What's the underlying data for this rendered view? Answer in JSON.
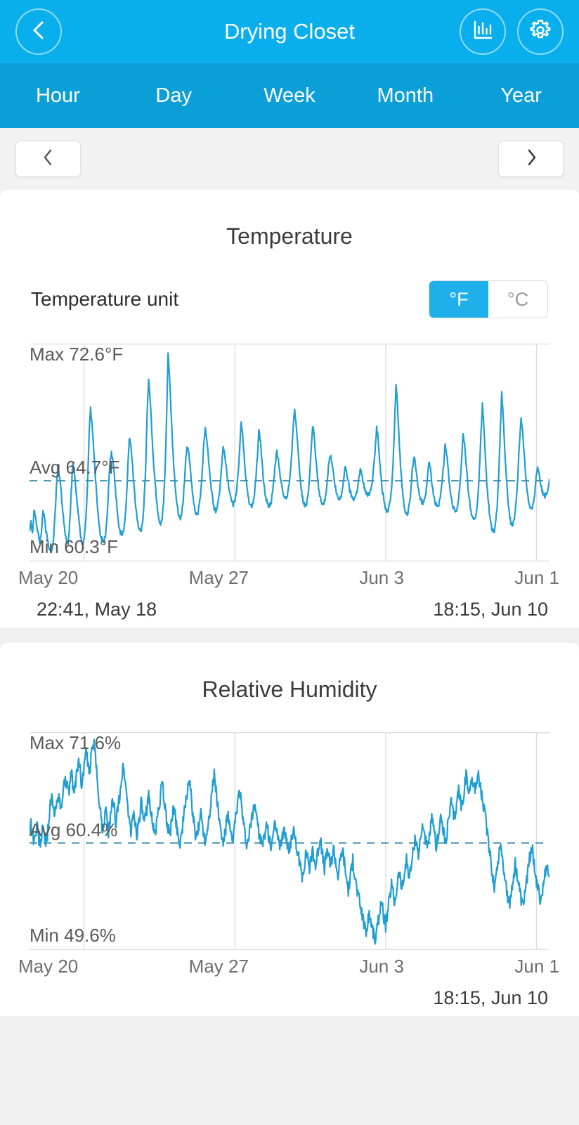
{
  "header": {
    "title": "Drying Closet",
    "back_icon": "chevron-left-icon",
    "chart_icon": "bar-chart-icon",
    "settings_icon": "gear-icon",
    "background": "#09aeec"
  },
  "period_tabs": [
    {
      "label": "Hour"
    },
    {
      "label": "Day"
    },
    {
      "label": "Week"
    },
    {
      "label": "Month"
    },
    {
      "label": "Year"
    }
  ],
  "pager": {
    "prev_icon": "chevron-left-icon",
    "next_icon": "chevron-right-icon"
  },
  "temperature_card": {
    "title": "Temperature",
    "unit_label": "Temperature unit",
    "units": [
      {
        "label": "°F",
        "selected": true
      },
      {
        "label": "°C",
        "selected": false
      }
    ],
    "max_label": "Max 72.6°F",
    "avg_label": "Avg 64.7°F",
    "min_label": "Min 60.3°F",
    "xticks": [
      "May 20",
      "May 27",
      "Jun 3",
      "Jun 1"
    ],
    "start_time": "22:41, May 18",
    "end_time": "18:15, Jun 10"
  },
  "humidity_card": {
    "title": "Relative Humidity",
    "max_label": "Max 71.6%",
    "avg_label": "Avg 60.4%",
    "min_label": "Min 49.6%",
    "xticks": [
      "May 20",
      "May 27",
      "Jun 3",
      "Jun 1"
    ],
    "end_time": "18:15, Jun 10"
  },
  "colors": {
    "accent": "#09aeec",
    "tab_bar": "#0b9fd8",
    "line": "#1f9ed4",
    "avg_line": "#3a8fb0",
    "grid": "#dedede"
  },
  "chart_data": [
    {
      "type": "line",
      "title": "Temperature",
      "ylabel": "°F",
      "xlabel": "",
      "grid": true,
      "legend": false,
      "ylim": [
        60.3,
        72.6
      ],
      "stats": {
        "max": 72.6,
        "avg": 64.7,
        "min": 60.3,
        "unit": "°F"
      },
      "xtick_labels": [
        "May 20",
        "May 27",
        "Jun 3",
        "Jun 1"
      ],
      "xtick_positions": [
        0.105,
        0.395,
        0.685,
        0.975
      ],
      "x_range": [
        "22:41, May 18",
        "18:15, Jun 10"
      ],
      "avg_line": 64.7,
      "values": [
        61.6,
        62.3,
        61.4,
        62.9,
        62.5,
        61.8,
        61.3,
        60.9,
        61.5,
        62.8,
        62.4,
        61.6,
        61.1,
        60.6,
        60.4,
        60.3,
        60.9,
        62.4,
        64.2,
        65.6,
        65.1,
        64.2,
        63.1,
        62.2,
        61.4,
        60.8,
        60.7,
        62.1,
        64.0,
        65.8,
        65.3,
        64.4,
        63.3,
        62.4,
        61.5,
        60.9,
        60.8,
        61.4,
        62.6,
        64.6,
        67.6,
        69.2,
        68.2,
        66.8,
        65.3,
        63.9,
        62.6,
        61.7,
        61.2,
        61.0,
        60.9,
        61.3,
        62.4,
        64.1,
        65.8,
        66.4,
        65.9,
        64.9,
        63.8,
        62.6,
        61.9,
        61.5,
        61.4,
        61.6,
        62.2,
        63.5,
        65.4,
        67.4,
        66.9,
        65.8,
        64.5,
        63.4,
        62.5,
        61.9,
        61.6,
        61.7,
        62.3,
        63.6,
        65.7,
        69.0,
        71.0,
        69.7,
        67.9,
        66.2,
        64.9,
        63.8,
        62.9,
        62.2,
        62.0,
        62.4,
        63.4,
        65.3,
        68.6,
        72.6,
        71.2,
        69.0,
        66.9,
        65.3,
        64.1,
        63.2,
        62.6,
        62.3,
        62.5,
        63.3,
        64.7,
        66.2,
        66.9,
        66.3,
        65.3,
        64.3,
        63.5,
        62.9,
        62.6,
        62.7,
        63.2,
        64.1,
        65.4,
        67.1,
        68.0,
        67.3,
        66.2,
        65.1,
        64.2,
        63.5,
        63.0,
        62.8,
        63.0,
        63.6,
        64.5,
        65.6,
        66.8,
        66.4,
        65.6,
        64.8,
        64.1,
        63.6,
        63.3,
        63.2,
        63.5,
        64.1,
        65.1,
        66.6,
        68.4,
        67.6,
        66.3,
        65.1,
        64.2,
        63.6,
        63.2,
        63.1,
        63.3,
        63.9,
        64.9,
        66.3,
        67.8,
        67.1,
        65.9,
        64.8,
        64.0,
        63.5,
        63.2,
        63.1,
        63.3,
        63.8,
        64.7,
        65.8,
        66.5,
        66.0,
        65.2,
        64.5,
        64.0,
        63.7,
        63.6,
        63.8,
        64.3,
        65.2,
        66.5,
        68.1,
        69.1,
        68.2,
        66.8,
        65.5,
        64.5,
        63.8,
        63.3,
        63.1,
        63.3,
        63.9,
        64.9,
        66.4,
        68.2,
        67.5,
        66.3,
        65.2,
        64.3,
        63.7,
        63.3,
        63.2,
        63.4,
        64.0,
        64.9,
        65.9,
        66.3,
        65.8,
        65.1,
        64.4,
        63.9,
        63.6,
        63.5,
        63.7,
        64.2,
        64.9,
        65.6,
        65.2,
        64.6,
        64.1,
        63.8,
        63.6,
        63.6,
        63.8,
        64.2,
        64.8,
        65.4,
        65.1,
        64.6,
        64.2,
        63.9,
        63.8,
        63.9,
        64.2,
        64.7,
        65.5,
        66.6,
        68.0,
        67.3,
        66.0,
        64.9,
        64.0,
        63.4,
        63.0,
        62.8,
        62.9,
        63.4,
        64.3,
        65.8,
        68.1,
        70.8,
        69.4,
        67.4,
        65.7,
        64.4,
        63.5,
        62.9,
        62.6,
        62.7,
        63.2,
        64.1,
        65.4,
        66.2,
        65.7,
        64.9,
        64.2,
        63.7,
        63.4,
        63.3,
        63.5,
        64.0,
        64.8,
        65.9,
        65.4,
        64.6,
        64.0,
        63.5,
        63.2,
        63.1,
        63.3,
        63.8,
        64.6,
        65.7,
        67.0,
        66.4,
        65.4,
        64.4,
        63.7,
        63.2,
        62.9,
        62.8,
        63.0,
        63.6,
        64.6,
        66.0,
        67.7,
        67.0,
        65.8,
        64.6,
        63.7,
        63.0,
        62.5,
        62.2,
        62.3,
        62.8,
        63.8,
        65.3,
        67.6,
        69.4,
        68.0,
        66.1,
        64.5,
        63.3,
        62.4,
        61.8,
        61.5,
        61.6,
        62.2,
        63.3,
        65.1,
        67.8,
        70.1,
        68.6,
        66.6,
        64.9,
        63.6,
        62.7,
        62.1,
        61.9,
        62.1,
        62.8,
        63.9,
        65.5,
        67.3,
        68.6,
        67.8,
        66.4,
        65.1,
        64.1,
        63.4,
        63.0,
        62.9,
        63.2,
        63.9,
        64.9,
        65.6,
        65.2,
        64.6,
        64.1,
        63.8,
        63.7,
        63.9,
        64.3,
        64.8
      ]
    },
    {
      "type": "line",
      "title": "Relative Humidity",
      "ylabel": "%",
      "xlabel": "",
      "grid": true,
      "legend": false,
      "ylim": [
        49.6,
        71.6
      ],
      "stats": {
        "max": 71.6,
        "avg": 60.4,
        "min": 49.6,
        "unit": "%"
      },
      "xtick_labels": [
        "May 20",
        "May 27",
        "Jun 3",
        "Jun 1"
      ],
      "xtick_positions": [
        0.105,
        0.395,
        0.685,
        0.975
      ],
      "x_range": [
        "22:41, May 18",
        "18:15, Jun 10"
      ],
      "avg_line": 60.4,
      "values": [
        61.8,
        62.6,
        61.4,
        60.6,
        61.2,
        62.4,
        61.1,
        60.2,
        61.0,
        62.0,
        61.3,
        60.5,
        61.4,
        63.0,
        64.6,
        65.4,
        64.2,
        63.4,
        64.6,
        66.0,
        65.0,
        64.0,
        65.2,
        66.6,
        67.8,
        66.9,
        65.8,
        66.8,
        68.2,
        67.0,
        65.8,
        67.0,
        68.6,
        69.8,
        68.4,
        66.9,
        68.0,
        69.4,
        70.6,
        69.3,
        67.9,
        69.2,
        70.8,
        71.6,
        70.2,
        68.4,
        66.6,
        64.8,
        63.2,
        61.8,
        62.8,
        64.2,
        63.0,
        61.6,
        62.6,
        64.0,
        65.2,
        64.0,
        62.8,
        63.8,
        65.0,
        66.4,
        67.8,
        69.0,
        67.6,
        66.0,
        64.4,
        62.9,
        61.6,
        62.6,
        63.8,
        62.6,
        61.4,
        62.4,
        63.6,
        64.8,
        63.6,
        62.4,
        63.4,
        64.6,
        65.8,
        64.6,
        63.4,
        62.2,
        61.2,
        62.2,
        63.4,
        64.6,
        65.8,
        67.0,
        65.6,
        64.2,
        63.0,
        62.0,
        61.2,
        62.2,
        63.4,
        64.4,
        63.2,
        62.0,
        61.0,
        60.4,
        61.4,
        62.6,
        63.8,
        65.0,
        66.4,
        67.6,
        66.2,
        64.6,
        63.0,
        61.6,
        60.6,
        61.6,
        62.8,
        63.8,
        62.6,
        61.4,
        60.6,
        61.6,
        62.8,
        64.0,
        65.4,
        66.8,
        68.0,
        66.6,
        65.0,
        63.4,
        62.0,
        61.0,
        60.4,
        61.2,
        62.4,
        63.6,
        62.4,
        61.2,
        60.5,
        61.5,
        62.7,
        63.9,
        65.1,
        66.3,
        64.9,
        63.3,
        61.9,
        60.8,
        60.1,
        60.8,
        61.8,
        62.8,
        63.8,
        65.0,
        64.0,
        62.8,
        61.6,
        60.6,
        60.0,
        60.6,
        61.6,
        62.6,
        61.6,
        60.6,
        60.2,
        60.8,
        61.6,
        62.4,
        61.4,
        60.4,
        60.0,
        60.6,
        61.4,
        62.2,
        61.2,
        60.2,
        59.4,
        60.2,
        61.2,
        62.0,
        61.0,
        60.0,
        59.2,
        58.4,
        57.6,
        56.8,
        57.6,
        58.6,
        59.6,
        58.6,
        57.6,
        58.6,
        59.8,
        58.8,
        57.8,
        58.8,
        60.0,
        61.0,
        59.8,
        58.6,
        57.6,
        58.6,
        59.8,
        58.8,
        57.8,
        58.8,
        59.8,
        58.8,
        57.8,
        56.8,
        57.8,
        58.8,
        59.8,
        58.6,
        57.4,
        56.2,
        55.2,
        56.2,
        57.4,
        58.4,
        57.2,
        56.0,
        55.0,
        54.2,
        53.4,
        52.6,
        51.8,
        51.0,
        50.4,
        51.4,
        52.6,
        51.8,
        51.0,
        50.2,
        49.6,
        50.4,
        51.6,
        52.8,
        54.0,
        53.0,
        52.0,
        51.2,
        52.2,
        53.4,
        54.6,
        55.8,
        54.8,
        53.8,
        54.8,
        56.0,
        57.2,
        56.2,
        55.2,
        56.2,
        57.4,
        58.6,
        57.6,
        56.6,
        57.6,
        58.8,
        60.0,
        61.2,
        60.2,
        59.2,
        60.2,
        61.4,
        62.6,
        61.6,
        60.6,
        59.6,
        60.6,
        61.8,
        63.0,
        62.0,
        61.0,
        60.0,
        61.0,
        62.2,
        63.4,
        62.4,
        61.4,
        60.4,
        61.4,
        62.6,
        63.8,
        65.0,
        64.0,
        63.0,
        64.0,
        65.2,
        66.4,
        65.4,
        64.4,
        65.4,
        66.6,
        67.8,
        66.8,
        65.8,
        66.8,
        68.0,
        67.0,
        66.0,
        67.0,
        68.2,
        67.2,
        66.2,
        65.2,
        64.2,
        63.2,
        62.0,
        60.6,
        59.2,
        57.8,
        56.6,
        55.6,
        56.6,
        57.8,
        59.0,
        60.4,
        59.2,
        58.0,
        56.8,
        55.6,
        54.4,
        53.4,
        54.4,
        55.6,
        56.8,
        58.0,
        57.0,
        56.0,
        55.0,
        54.0,
        53.2,
        54.2,
        55.4,
        56.6,
        57.8,
        59.0,
        60.2,
        59.0,
        57.8,
        56.6,
        55.4,
        54.6,
        54.0,
        54.6,
        55.6,
        56.8,
        58.0,
        57.0,
        56.6
      ]
    }
  ]
}
